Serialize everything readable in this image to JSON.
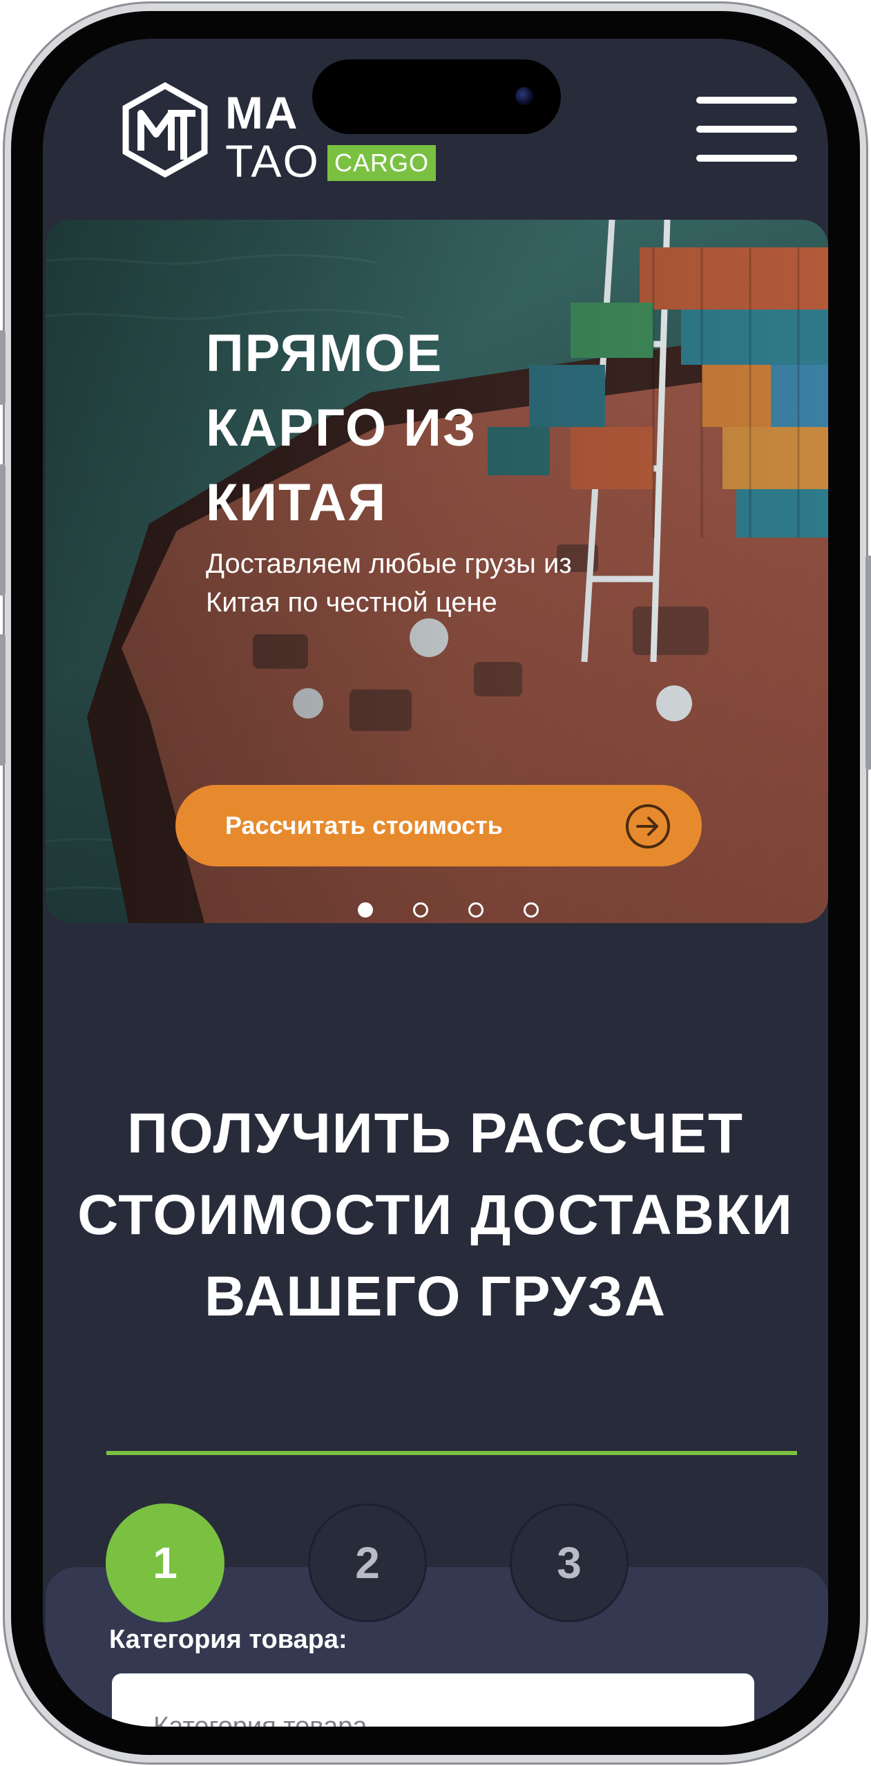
{
  "brand": {
    "line1": "MA",
    "line2": "TAO",
    "badge": "CARGO",
    "accent": "#7ac142"
  },
  "header": {
    "menu_icon": "hamburger-menu-icon"
  },
  "hero": {
    "title": "ПРЯМОЕ КАРГО ИЗ КИТАЯ",
    "subtitle": "Доставляем любые грузы из Китая по честной цене",
    "cta_label": "Рассчитать стоимость",
    "cta_icon": "arrow-right-circle-icon",
    "cta_color": "#e78a2e",
    "slides": 4,
    "active_slide": 1
  },
  "calculator": {
    "title": "ПОЛУЧИТЬ РАССЧЕТ СТОИМОСТИ ДОСТАВКИ ВАШЕГО ГРУЗА",
    "steps": [
      "1",
      "2",
      "3"
    ],
    "active_step": 1,
    "category_label": "Категория товара:",
    "category_placeholder": "Категория товара"
  },
  "theme": {
    "background": "#282b3a",
    "card": "#343951"
  }
}
